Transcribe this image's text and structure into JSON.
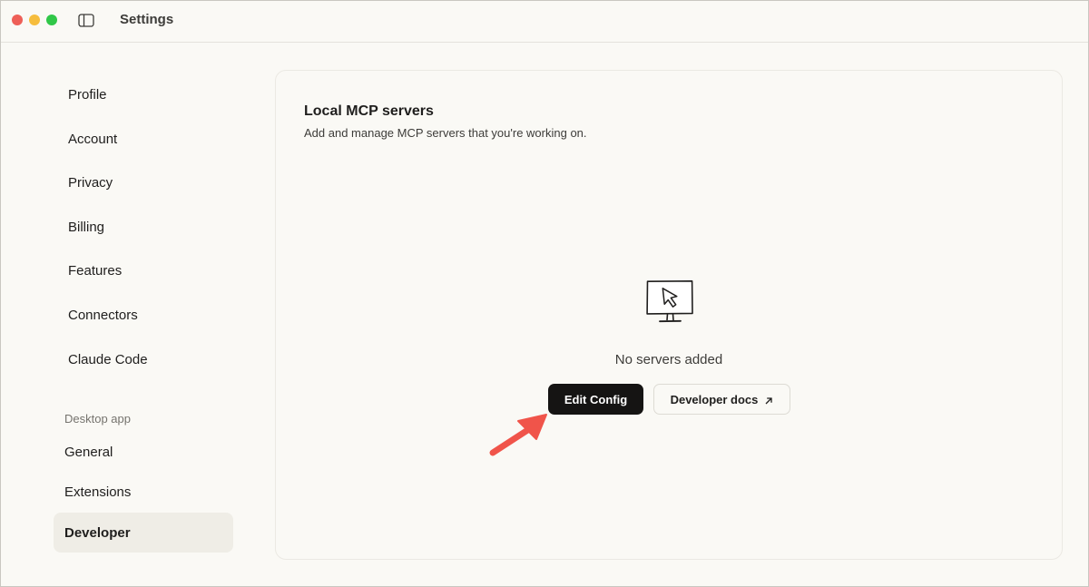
{
  "window": {
    "title": "Settings",
    "traffic_lights": [
      "#ee5f57",
      "#f6bd3d",
      "#30c748"
    ],
    "sidebar_toggle_icon": "sidebar-toggle-icon"
  },
  "sidebar": {
    "items": [
      {
        "label": "Profile"
      },
      {
        "label": "Account"
      },
      {
        "label": "Privacy"
      },
      {
        "label": "Billing"
      },
      {
        "label": "Features"
      },
      {
        "label": "Connectors"
      },
      {
        "label": "Claude Code"
      }
    ],
    "section_label": "Desktop app",
    "section_items": [
      {
        "label": "General"
      },
      {
        "label": "Extensions"
      },
      {
        "label": "Developer",
        "active": true
      }
    ]
  },
  "main": {
    "title": "Local MCP servers",
    "subtitle": "Add and manage MCP servers that you're working on.",
    "empty_icon": "monitor-cursor-icon",
    "empty_text": "No servers added",
    "primary_button": "Edit Config",
    "secondary_button": "Developer docs",
    "secondary_button_icon": "external-link-icon"
  },
  "annotation": {
    "icon": "pointer-arrow-icon",
    "color": "#f0544a"
  },
  "colors": {
    "background": "#faf9f5",
    "active_item": "#efede6",
    "primary_button": "#151413"
  }
}
